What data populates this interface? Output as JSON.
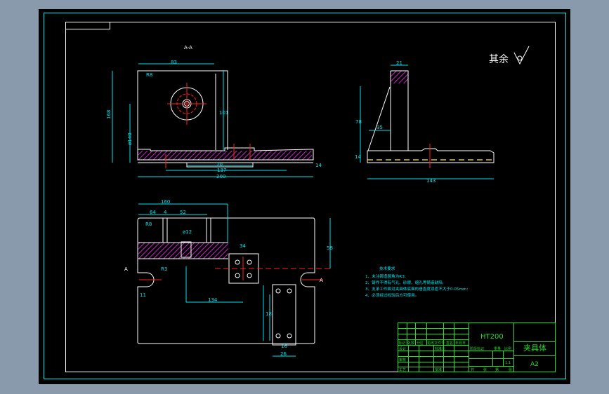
{
  "drawing": {
    "section_label": "A-A",
    "roughness_note": "其余",
    "top_view_dims": [
      "83",
      "R8",
      "168",
      "ø140",
      "101",
      "70",
      "137",
      "200",
      "14",
      "R3",
      "34"
    ],
    "right_view_dims": [
      "21",
      "78",
      "35",
      "14",
      "143"
    ],
    "bottom_view_dims": [
      "160",
      "64",
      "4",
      "52",
      "R8",
      "R3",
      "ø12",
      "11",
      "134",
      "34",
      "16",
      "58",
      "18",
      "26",
      "4"
    ],
    "section_marks": [
      "A",
      "A"
    ]
  },
  "tech_requirements": {
    "title": "技术要求",
    "items": [
      "1、未注铸造圆角为R3;",
      "2、铸件不得有气孔、砂眼、缩孔等铸造缺陷;",
      "3、支承工作面对夹具体底面的垂直度误差不大于0.05mm;",
      "4、必须经过检验后方可使用。"
    ]
  },
  "title_block": {
    "material": "HT200",
    "part_name": "夹具体",
    "sheet_size": "A2",
    "scale": "1:1",
    "rev_headers": [
      "标记",
      "处数",
      "分区",
      "更改文件号",
      "签名",
      "年月日"
    ],
    "left_labels": [
      "设计",
      "审核",
      "工艺"
    ],
    "mid_labels": [
      "标准化",
      "",
      "批准"
    ],
    "stage_headers": [
      "阶段标记",
      "重量",
      "比例"
    ],
    "sheet_count": [
      "共",
      "张",
      "第",
      "张"
    ]
  },
  "colors": {
    "background": "#000000",
    "frame": "#00e5ee",
    "outline": "#ffffff",
    "hatch": "#cc22cc",
    "title_block": "#22dd22"
  }
}
